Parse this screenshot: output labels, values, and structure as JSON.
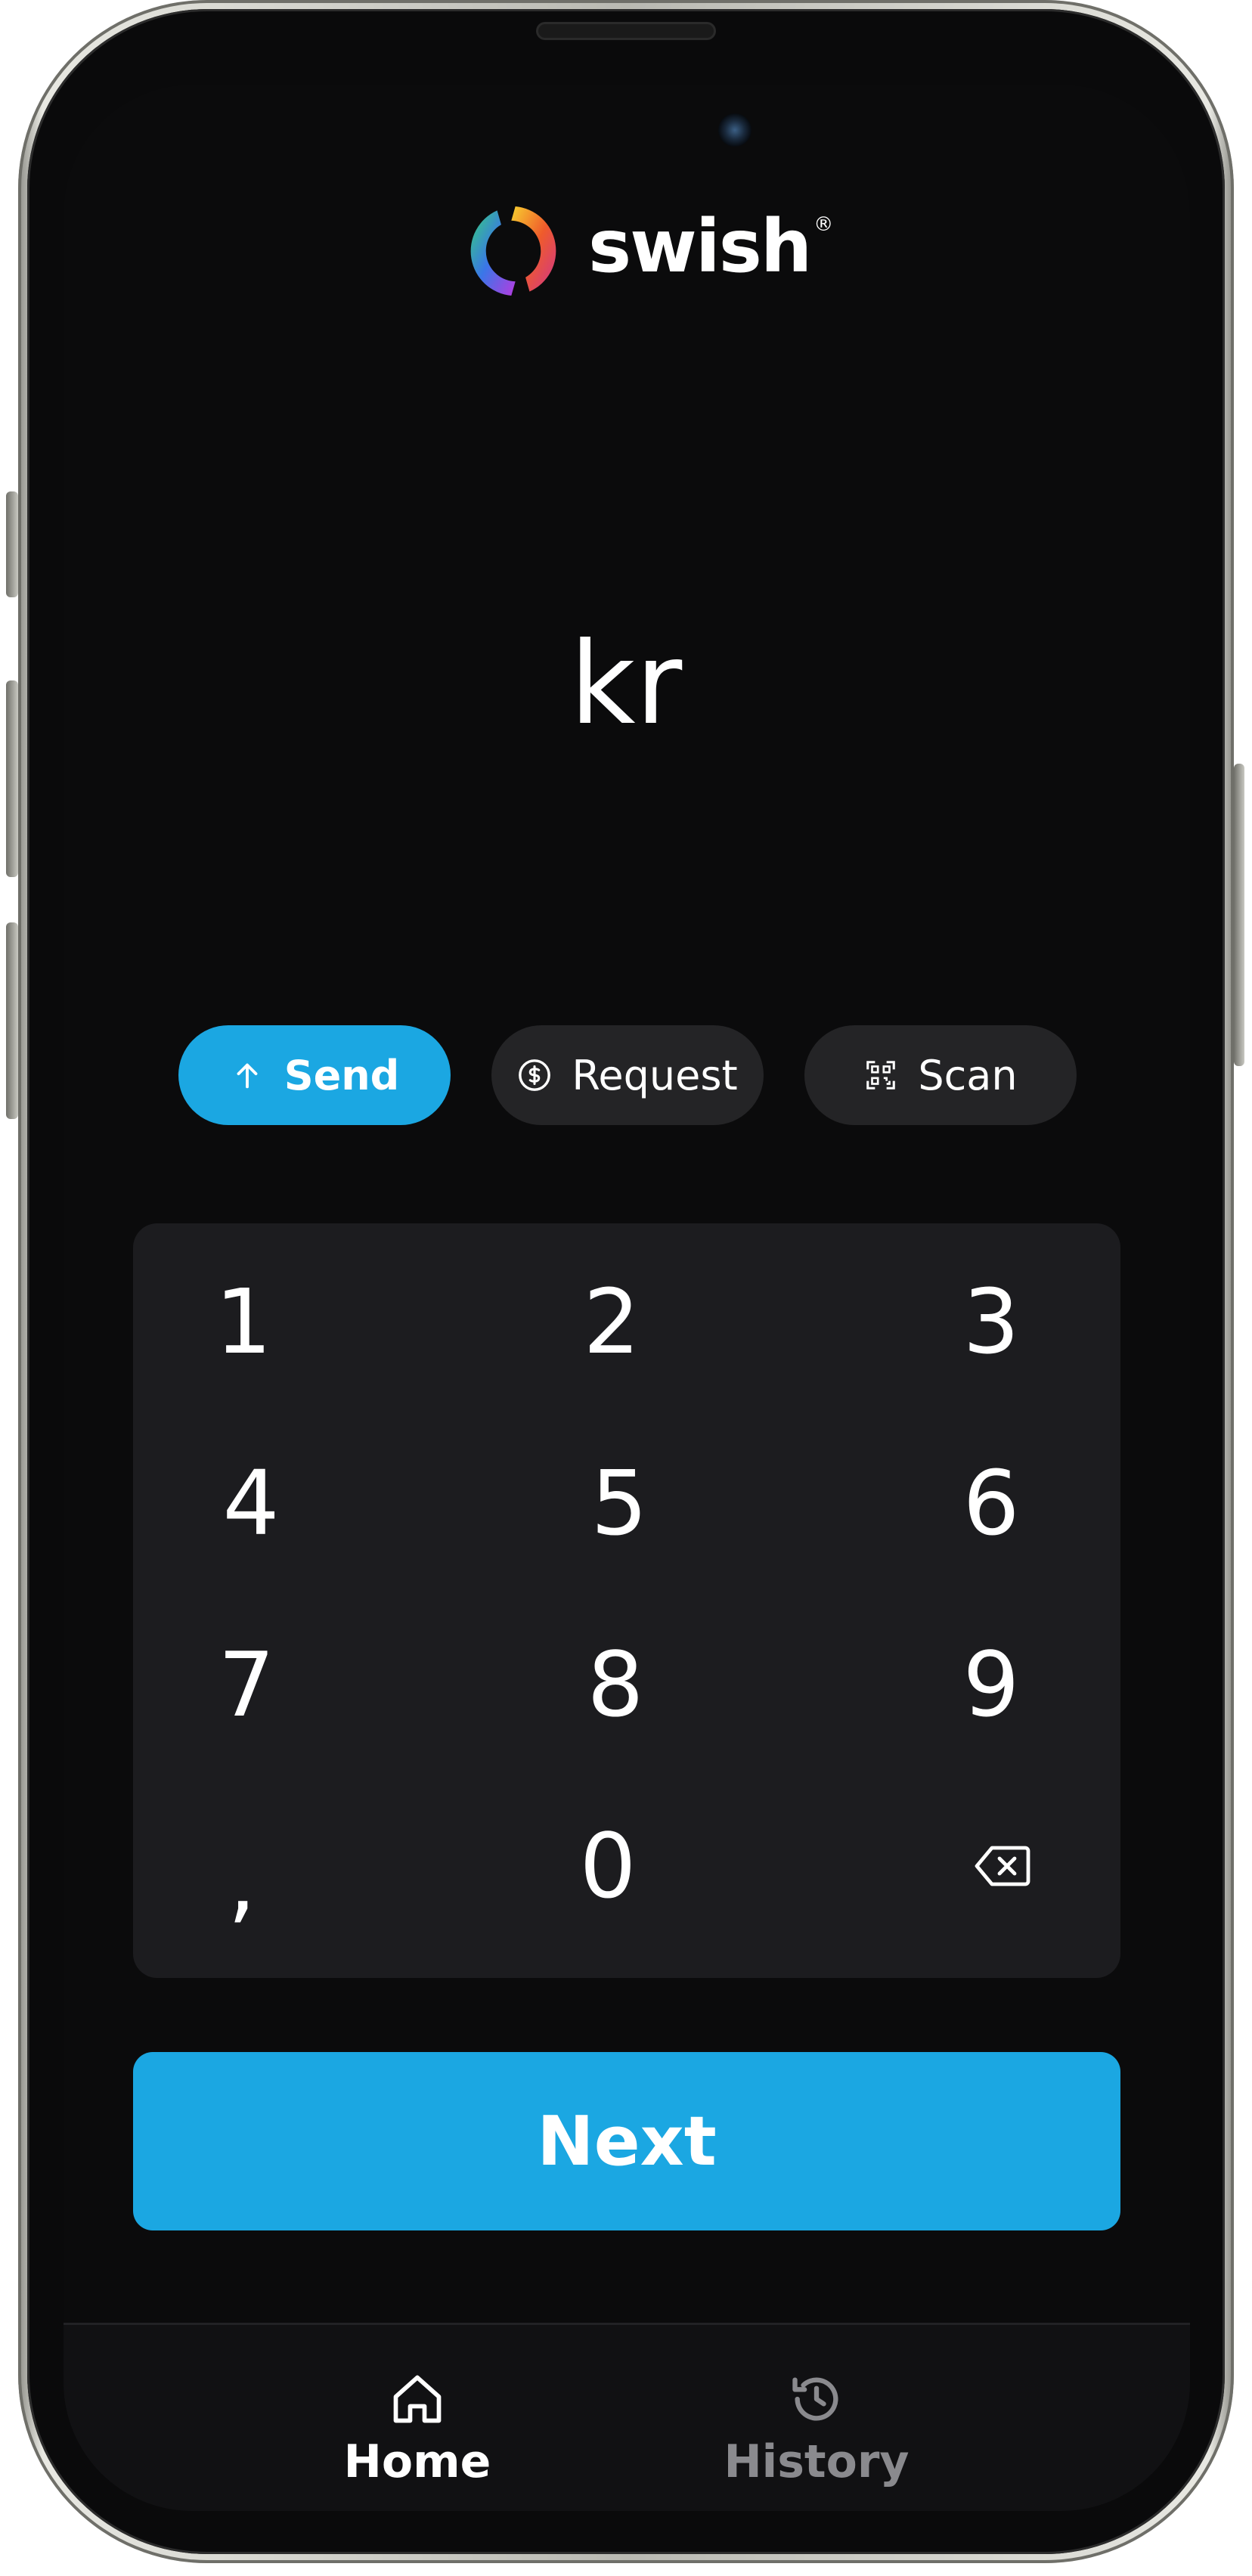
{
  "app": {
    "brand": "swish",
    "brand_mark": "®"
  },
  "amount": {
    "currency": "kr"
  },
  "mode": {
    "send_label": "Send",
    "request_label": "Request",
    "scan_label": "Scan",
    "selected": "Send"
  },
  "keypad": {
    "keys": [
      "1",
      "2",
      "3",
      "4",
      "5",
      "6",
      "7",
      "8",
      "9",
      ",",
      "0"
    ],
    "backspace_icon": "backspace-icon"
  },
  "next_button": {
    "label": "Next"
  },
  "tabbar": {
    "home_label": "Home",
    "history_label": "History",
    "active": "Home"
  },
  "colors": {
    "accent": "#1ba7e2",
    "background": "#0b0b0c",
    "keypad_bg": "#1c1c1f",
    "pill_bg": "#242426",
    "inactive_tab": "#8a8a8e"
  }
}
